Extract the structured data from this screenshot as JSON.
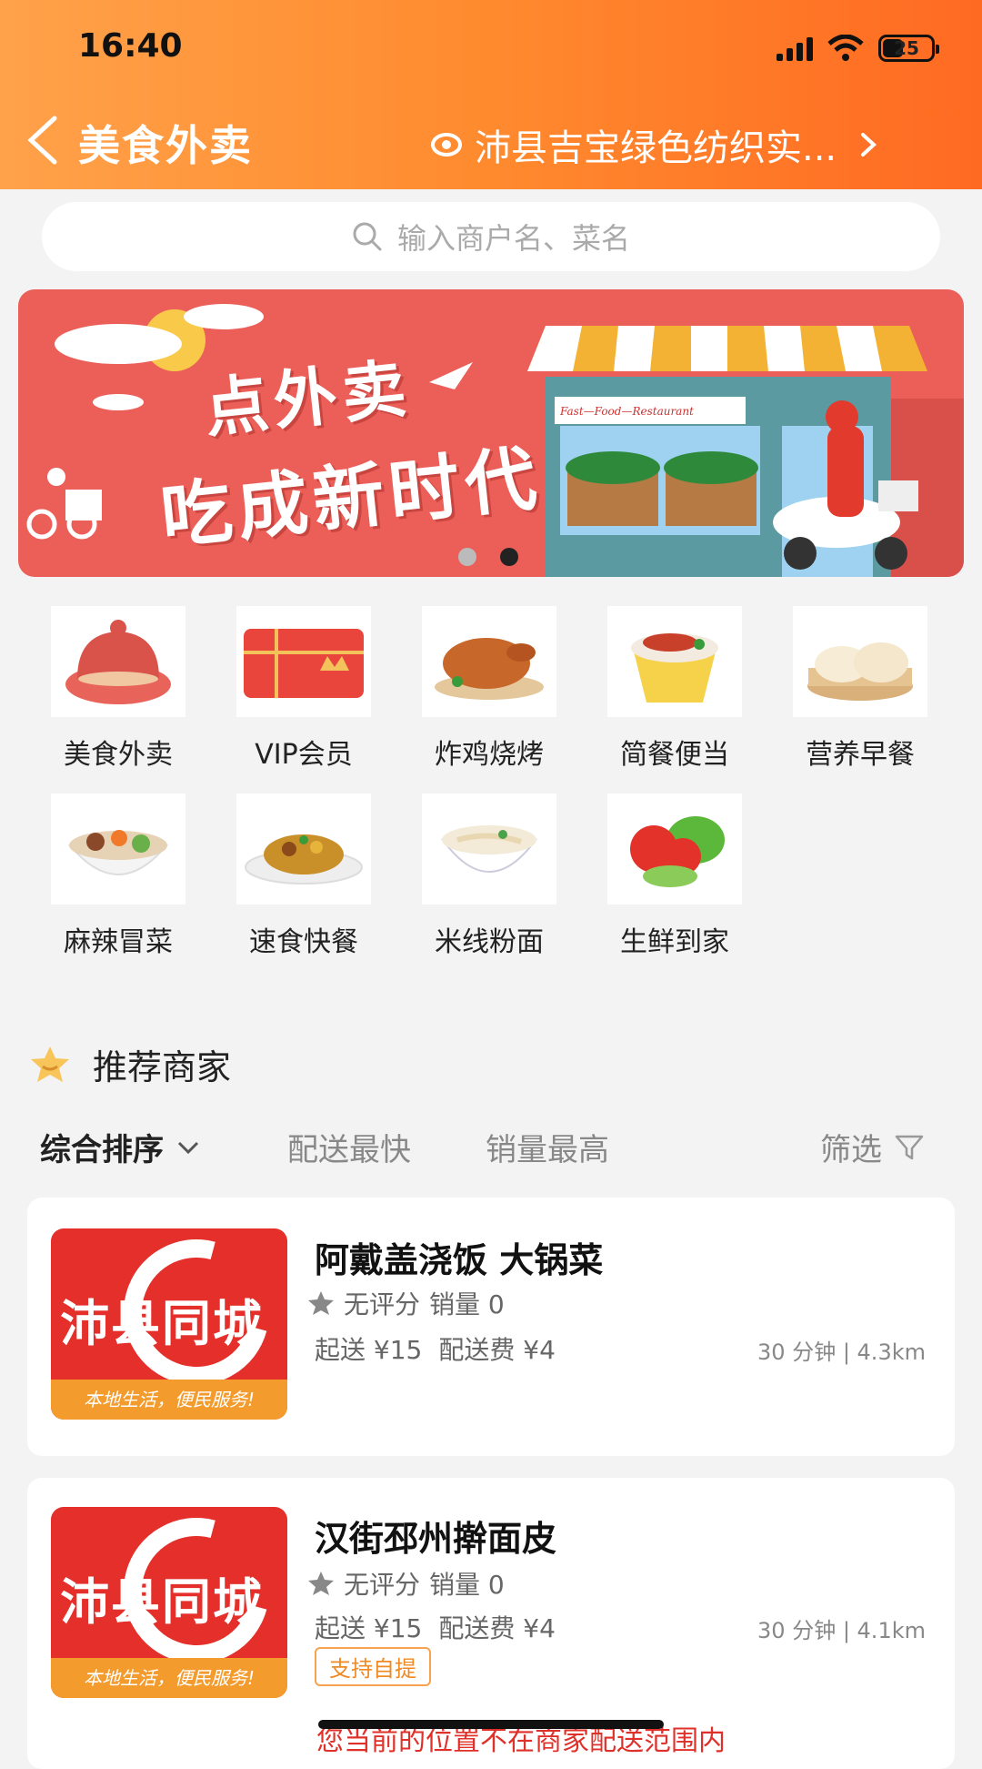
{
  "status": {
    "time": "16:40",
    "battery": "25"
  },
  "nav": {
    "title": "美食外卖",
    "location": "沛县吉宝绿色纺织实..."
  },
  "search": {
    "placeholder": "输入商户名、菜名"
  },
  "banner": {
    "line1": "点外卖",
    "line2": "吃成新时代",
    "shop_sign": "Fast—Food—Restaurant",
    "active_dot": 2,
    "dot_count": 2
  },
  "categories": [
    {
      "label": "美食外卖",
      "icon": "food-delivery-icon"
    },
    {
      "label": "VIP会员",
      "icon": "vip-card-icon"
    },
    {
      "label": "炸鸡烧烤",
      "icon": "fried-chicken-icon"
    },
    {
      "label": "简餐便当",
      "icon": "bento-icon"
    },
    {
      "label": "营养早餐",
      "icon": "breakfast-bun-icon"
    },
    {
      "label": "麻辣冒菜",
      "icon": "spicy-bowl-icon"
    },
    {
      "label": "速食快餐",
      "icon": "fast-food-icon"
    },
    {
      "label": "米线粉面",
      "icon": "noodle-bowl-icon"
    },
    {
      "label": "生鲜到家",
      "icon": "fresh-vegetable-icon"
    }
  ],
  "section": {
    "title": "推荐商家"
  },
  "sort": {
    "comprehensive": "综合排序",
    "fastest": "配送最快",
    "top_sales": "销量最高",
    "filter": "筛选"
  },
  "shops": [
    {
      "name": "阿戴盖浇饭 大锅菜",
      "rating": "无评分",
      "sales": "销量 0",
      "min_order": "起送 ¥15",
      "delivery_fee": "配送费 ¥4",
      "eta_distance": "30 分钟 | 4.3km",
      "logo_text": "沛县同城",
      "logo_slogan": "本地生活，便民服务!"
    },
    {
      "name": "汉街邳州擀面皮",
      "rating": "无评分",
      "sales": "销量 0",
      "min_order": "起送 ¥15",
      "delivery_fee": "配送费 ¥4",
      "eta_distance": "30 分钟 | 4.1km",
      "tag": "支持自提",
      "logo_text": "沛县同城",
      "logo_slogan": "本地生活，便民服务!"
    }
  ],
  "warning": "您当前的位置不在商家配送范围内",
  "colors": {
    "header_start": "#ffa24a",
    "header_end": "#ff6a22",
    "banner": "#ec5e58",
    "logo_red": "#e52f2a",
    "tag": "#f08a24"
  }
}
